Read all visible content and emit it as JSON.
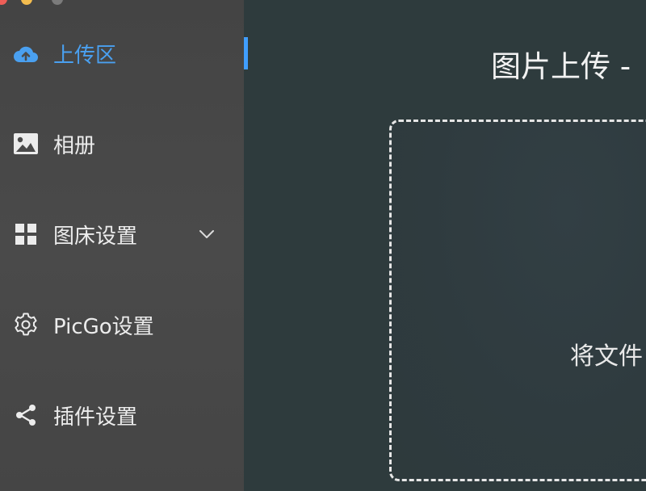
{
  "sidebar": {
    "items": [
      {
        "label": "上传区",
        "icon": "cloud-upload-icon",
        "active": true
      },
      {
        "label": "相册",
        "icon": "image-icon"
      },
      {
        "label": "图床设置",
        "icon": "grid-icon",
        "expandable": true
      },
      {
        "label": "PicGo设置",
        "icon": "gear-icon"
      },
      {
        "label": "插件设置",
        "icon": "share-icon"
      }
    ]
  },
  "main": {
    "title": "图片上传 -",
    "drop_text": "将文件"
  },
  "colors": {
    "accent": "#409eff",
    "sidebar_bg": "#4a4a4a",
    "main_bg": "#2e3b3d"
  }
}
